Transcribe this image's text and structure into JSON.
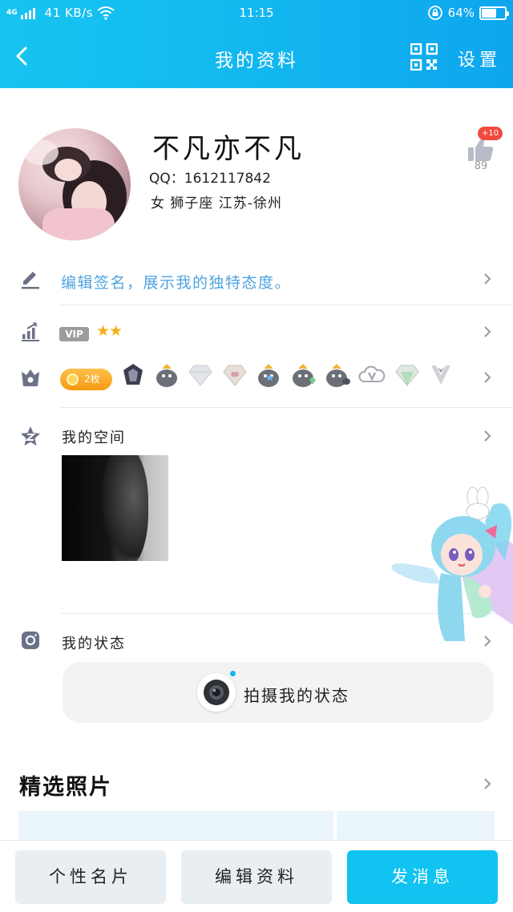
{
  "status_bar": {
    "network": "4G",
    "speed": "41 KB/s",
    "time": "11:15",
    "battery": "64%",
    "battery_level": 0.64
  },
  "nav": {
    "title": "我的资料",
    "settings_label": "设置",
    "icons": {
      "back": "chevron-left-icon",
      "qr": "qr-code-icon"
    }
  },
  "profile": {
    "nickname": "不凡亦不凡",
    "qq_line": "QQ：1612117842",
    "info": "女  狮子座  江苏-徐州",
    "like_badge": "+10",
    "like_count": "89"
  },
  "signature": {
    "placeholder": "编辑签名，展示我的独特态度。"
  },
  "vip": {
    "badge": "VIP",
    "stars": "★★"
  },
  "medals": {
    "count_label": "2枚"
  },
  "space": {
    "title": "我的空间"
  },
  "status": {
    "title": "我的状态",
    "action_label": "拍摄我的状态"
  },
  "photos": {
    "title": "精选照片"
  },
  "bottom": {
    "card_label": "个性名片",
    "edit_label": "编辑资料",
    "message_label": "发消息"
  },
  "colors": {
    "header": "#12b6ef",
    "accent_blue": "#10c3f0",
    "link_blue": "#4fa3e0",
    "like_badge": "#f04a40",
    "medal_orange": "#f5a623"
  }
}
